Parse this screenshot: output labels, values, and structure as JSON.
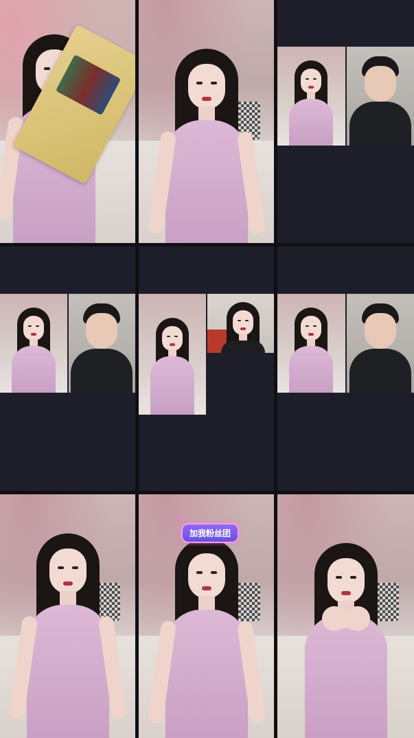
{
  "grid": {
    "cells": [
      {
        "id": "stream-1",
        "layout": "full",
        "variant": "holding-package"
      },
      {
        "id": "stream-2",
        "layout": "full",
        "variant": "seated"
      },
      {
        "id": "stream-3",
        "layout": "split"
      },
      {
        "id": "stream-4",
        "layout": "split"
      },
      {
        "id": "stream-5",
        "layout": "triple"
      },
      {
        "id": "stream-6",
        "layout": "split"
      },
      {
        "id": "stream-7",
        "layout": "full",
        "variant": "dancing"
      },
      {
        "id": "stream-8",
        "layout": "full",
        "variant": "with-badge"
      },
      {
        "id": "stream-9",
        "layout": "full",
        "variant": "heart-hands"
      }
    ]
  },
  "badge": {
    "text": "加我粉丝团"
  },
  "colors": {
    "background": "#0f0f14",
    "empty_panel": "#1e1e2a",
    "dress": "#c9a0c4",
    "badge": "#7a5bea"
  }
}
